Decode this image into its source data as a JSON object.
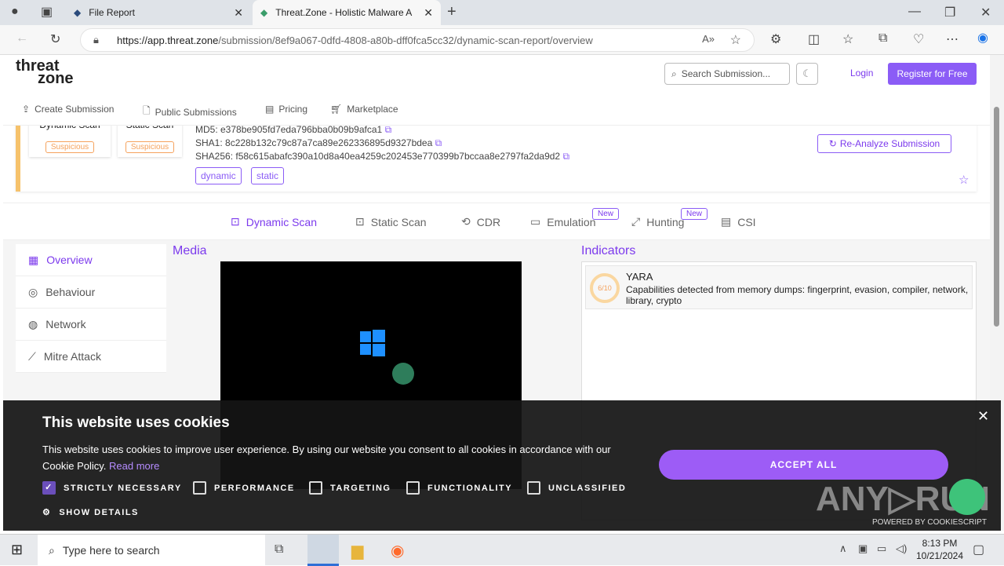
{
  "browser": {
    "tabs": [
      {
        "title": "File Report",
        "active": false
      },
      {
        "title": "Threat.Zone - Holistic Malware A",
        "active": true
      }
    ],
    "url_host": "https://app.threat.zone",
    "url_path": "/submission/8ef9a067-0dfd-4808-a80b-dff0fca5cc32/dynamic-scan-report/overview"
  },
  "header": {
    "logo_line1": "threat",
    "logo_line2": "zone",
    "search_placeholder": "Search Submission...",
    "login": "Login",
    "register": "Register for Free",
    "nav": [
      "Create Submission",
      "Public Submissions",
      "Pricing",
      "Marketplace"
    ]
  },
  "summary": {
    "scans": [
      {
        "label": "Dynamic Scan",
        "verdict": "Suspicious"
      },
      {
        "label": "Static Scan",
        "verdict": "Suspicious"
      }
    ],
    "md5": "MD5: e378be905fd7eda796bba0b09b9afca1",
    "sha1": "SHA1: 8c228b132c79c87a7ca89e262336895d9327bdea",
    "sha256": "SHA256: f58c615abafc390a10d8a40ea4259c202453e770399b7bccaa8e2797fa2da9d2",
    "tags": [
      "dynamic",
      "static"
    ],
    "reanalyze": "Re-Analyze Submission"
  },
  "scan_tabs": [
    {
      "label": "Dynamic Scan",
      "active": true,
      "badge": ""
    },
    {
      "label": "Static Scan",
      "active": false,
      "badge": ""
    },
    {
      "label": "CDR",
      "active": false,
      "badge": ""
    },
    {
      "label": "Emulation",
      "active": false,
      "badge": "New"
    },
    {
      "label": "Hunting",
      "active": false,
      "badge": "New"
    },
    {
      "label": "CSI",
      "active": false,
      "badge": ""
    }
  ],
  "sidebar": [
    "Overview",
    "Behaviour",
    "Network",
    "Mitre Attack"
  ],
  "media_title": "Media",
  "indicators": {
    "title": "Indicators",
    "items": [
      {
        "score": "6/10",
        "name": "YARA",
        "desc": "Capabilities detected from memory dumps: fingerprint, evasion, compiler, network, library, crypto"
      }
    ]
  },
  "cookie": {
    "title": "This website uses cookies",
    "text": "This website uses cookies to improve user experience. By using our website you consent to all cookies in accordance with our Cookie Policy.",
    "read_more": "Read more",
    "options": [
      {
        "label": "STRICTLY NECESSARY",
        "checked": true
      },
      {
        "label": "PERFORMANCE",
        "checked": false
      },
      {
        "label": "TARGETING",
        "checked": false
      },
      {
        "label": "FUNCTIONALITY",
        "checked": false
      },
      {
        "label": "UNCLASSIFIED",
        "checked": false
      }
    ],
    "accept": "ACCEPT ALL",
    "show_details": "SHOW DETAILS",
    "powered": "POWERED BY COOKIESCRIPT"
  },
  "taskbar": {
    "search_placeholder": "Type here to search",
    "time": "8:13 PM",
    "date": "10/21/2024"
  }
}
